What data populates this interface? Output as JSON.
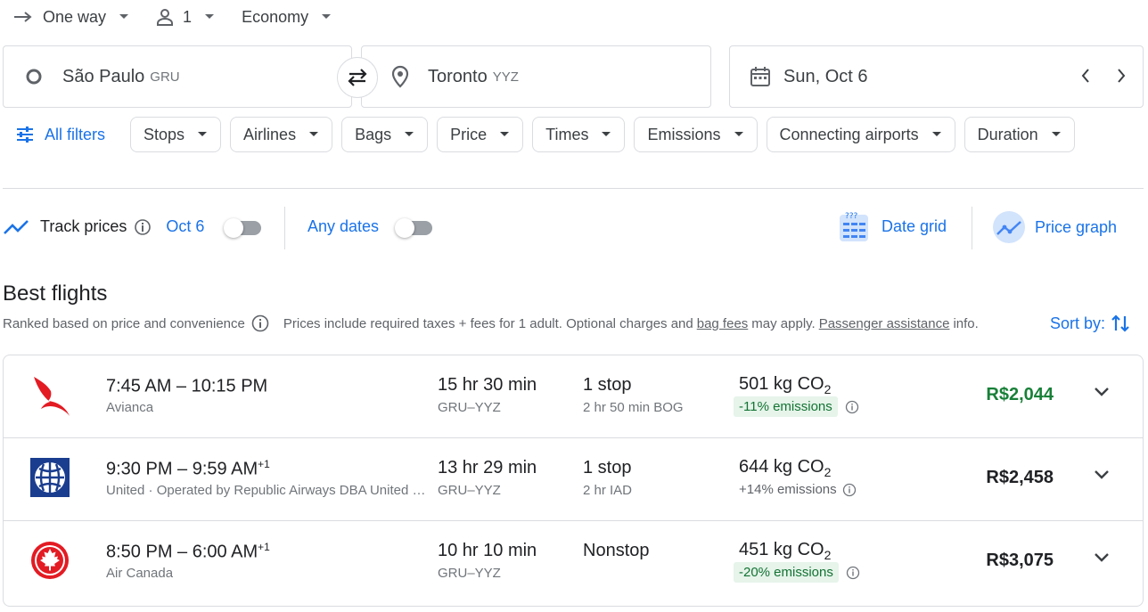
{
  "top": {
    "trip_type": "One way",
    "passengers": "1",
    "cabin": "Economy"
  },
  "search": {
    "origin": "São Paulo",
    "origin_code": "GRU",
    "destination": "Toronto",
    "destination_code": "YYZ",
    "date": "Sun, Oct 6"
  },
  "filters": {
    "all_filters": "All filters",
    "chips": [
      "Stops",
      "Airlines",
      "Bags",
      "Price",
      "Times",
      "Emissions",
      "Connecting airports",
      "Duration"
    ]
  },
  "tracking": {
    "track_prices": "Track prices",
    "date_label": "Oct 6",
    "any_dates": "Any dates",
    "date_grid": "Date grid",
    "price_graph": "Price graph"
  },
  "results": {
    "title": "Best flights",
    "ranked": "Ranked based on price and convenience",
    "prices_note": "Prices include required taxes + fees for 1 adult. Optional charges and",
    "bag_fees": "bag fees",
    "may_apply": "may apply.",
    "assistance": "Passenger assistance",
    "info": "info.",
    "sort_by": "Sort by:"
  },
  "flights": [
    {
      "times": "7:45 AM – 10:15 PM",
      "day_offset": "",
      "airline": "Avianca",
      "duration": "15 hr 30 min",
      "route": "GRU–YYZ",
      "stops": "1 stop",
      "stop_info": "2 hr 50 min BOG",
      "co2": "501 kg CO",
      "co2_sub": "2",
      "emissions": "-11% emissions",
      "price": "R$2,044"
    },
    {
      "times": "9:30 PM – 9:59 AM",
      "day_offset": "+1",
      "airline": "United · Operated by Republic Airways DBA United Express",
      "duration": "13 hr 29 min",
      "route": "GRU–YYZ",
      "stops": "1 stop",
      "stop_info": "2 hr IAD",
      "co2": "644 kg CO",
      "co2_sub": "2",
      "emissions": "+14% emissions",
      "price": "R$2,458"
    },
    {
      "times": "8:50 PM – 6:00 AM",
      "day_offset": "+1",
      "airline": "Air Canada",
      "duration": "10 hr 10 min",
      "route": "GRU–YYZ",
      "stops": "Nonstop",
      "stop_info": "",
      "co2": "451 kg CO",
      "co2_sub": "2",
      "emissions": "-20% emissions",
      "price": "R$3,075"
    }
  ],
  "colors": {
    "accent": "#1a73e8",
    "good_price": "#188038",
    "emission_pill_bg": "#e6f4ea"
  }
}
